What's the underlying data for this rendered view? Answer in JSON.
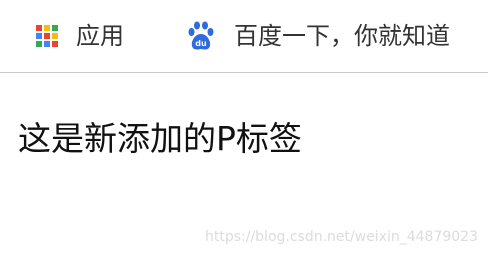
{
  "bookmarks_bar": {
    "apps": {
      "label": "应用",
      "icon": "apps-grid-icon",
      "dot_colors": [
        "#ea4335",
        "#fbbc05",
        "#34a853",
        "#4285f4",
        "#ea4335",
        "#fbbc05",
        "#34a853",
        "#4285f4",
        "#ea4335"
      ]
    },
    "baidu": {
      "label": "百度一下，你就知道",
      "icon": "baidu-paw-icon",
      "icon_text": "du",
      "color": "#2e6bdf"
    }
  },
  "content": {
    "paragraph": "这是新添加的P标签"
  },
  "watermark": "https://blog.csdn.net/weixin_44879023"
}
